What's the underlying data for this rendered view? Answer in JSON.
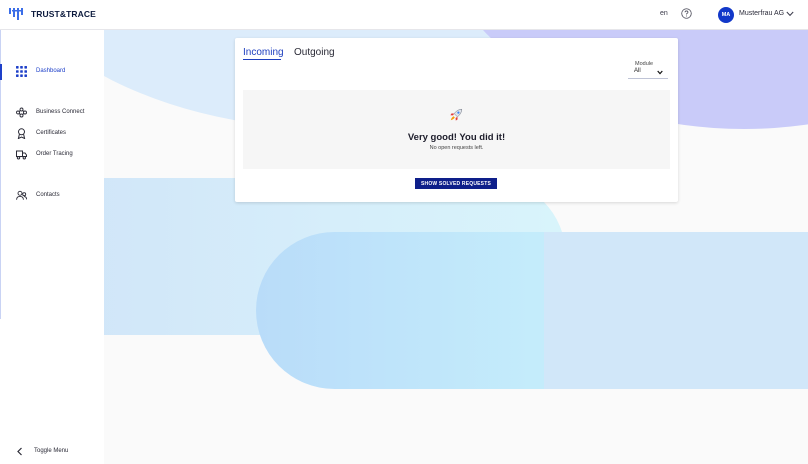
{
  "app": {
    "brand": "TRUST&TRACE"
  },
  "header": {
    "language": "en",
    "user_initials": "MA",
    "account_name": "Musterfrau AG"
  },
  "sidebar": {
    "items": [
      {
        "label": "Dashboard",
        "icon": "grid-icon",
        "active": true
      },
      {
        "label": "Business Connect",
        "icon": "network-icon"
      },
      {
        "label": "Certificates",
        "icon": "certificate-icon"
      },
      {
        "label": "Order Tracing",
        "icon": "truck-icon"
      },
      {
        "label": "Contacts",
        "icon": "contacts-icon"
      }
    ],
    "toggle_label": "Toggle Menu"
  },
  "requests": {
    "tabs": [
      {
        "label": "Incoming",
        "active": true
      },
      {
        "label": "Outgoing"
      }
    ],
    "module_filter": {
      "label": "Module",
      "value": "All"
    },
    "empty_state": {
      "title": "Very good! You did it!",
      "subtitle": "No open requests left.",
      "icon": "rocket-icon"
    },
    "show_solved_button": "SHOW SOLVED REQUESTS"
  },
  "colors": {
    "accent": "#1e40c9",
    "button": "#0e1f8a",
    "avatar": "#1238c9"
  }
}
